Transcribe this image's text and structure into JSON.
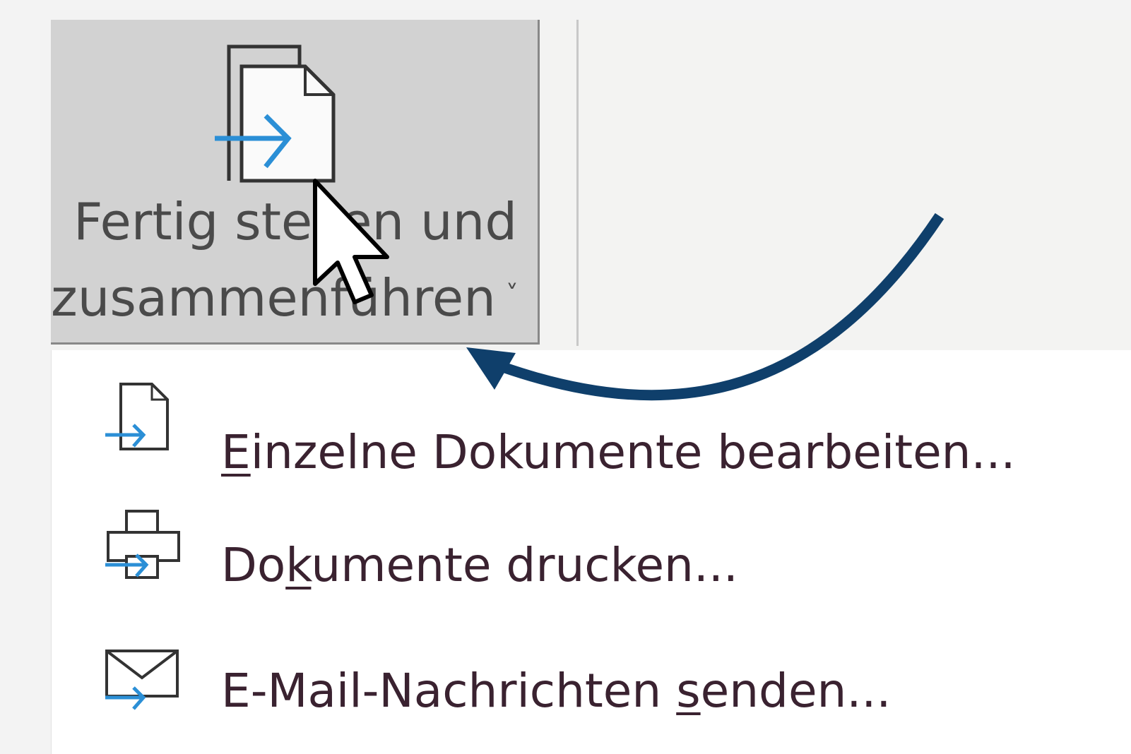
{
  "ribbon": {
    "finish_button": {
      "line1": "Fertig stellen und",
      "line2": "zusammenführen",
      "chevron": "˅",
      "icon": "finish-merge-icon"
    }
  },
  "menu": {
    "items": [
      {
        "pre": "",
        "accel": "E",
        "post": "inzelne Dokumente bearbeiten...",
        "icon": "edit-documents-icon"
      },
      {
        "pre": "Do",
        "accel": "k",
        "post": "umente drucken...",
        "icon": "print-documents-icon"
      },
      {
        "pre": "E-Mail-Nachrichten ",
        "accel": "s",
        "post": "enden...",
        "icon": "email-messages-icon"
      }
    ]
  },
  "colors": {
    "menu_text": "#3a2230",
    "accent_blue": "#2b8fd6",
    "annotation_arrow": "#0f3f6b",
    "button_hover": "#d2d2d2"
  }
}
